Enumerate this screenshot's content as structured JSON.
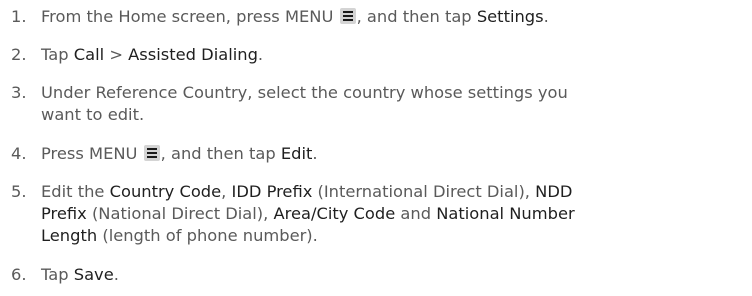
{
  "steps": [
    {
      "number": "1.",
      "segments": [
        {
          "t": "From the Home screen, press MENU "
        },
        {
          "icon": "menu-icon"
        },
        {
          "t": ", and then tap "
        },
        {
          "t": "Settings",
          "b": true
        },
        {
          "t": "."
        }
      ]
    },
    {
      "number": "2.",
      "segments": [
        {
          "t": "Tap "
        },
        {
          "t": "Call",
          "b": true
        },
        {
          "t": " > "
        },
        {
          "t": "Assisted Dialing",
          "b": true
        },
        {
          "t": "."
        }
      ]
    },
    {
      "number": "3.",
      "segments": [
        {
          "t": "Under Reference Country, select the country whose settings you"
        },
        {
          "br": true
        },
        {
          "t": "want to edit."
        }
      ]
    },
    {
      "number": "4.",
      "segments": [
        {
          "t": "Press MENU "
        },
        {
          "icon": "menu-icon"
        },
        {
          "t": ", and then tap "
        },
        {
          "t": "Edit",
          "b": true
        },
        {
          "t": "."
        }
      ]
    },
    {
      "number": "5.",
      "segments": [
        {
          "t": "Edit the "
        },
        {
          "t": "Country Code",
          "b": true
        },
        {
          "t": ", "
        },
        {
          "t": "IDD Prefix",
          "b": true
        },
        {
          "t": " (International Direct Dial), "
        },
        {
          "t": "NDD",
          "b": true
        },
        {
          "br": true
        },
        {
          "t": "Prefix",
          "b": true
        },
        {
          "t": " (National Direct Dial), "
        },
        {
          "t": "Area/City Code",
          "b": true
        },
        {
          "t": " and "
        },
        {
          "t": "National Number",
          "b": true
        },
        {
          "br": true
        },
        {
          "t": "Length",
          "b": true
        },
        {
          "t": " (length of phone number)."
        }
      ]
    },
    {
      "number": "6.",
      "segments": [
        {
          "t": "Tap "
        },
        {
          "t": "Save",
          "b": true
        },
        {
          "t": "."
        }
      ]
    }
  ]
}
